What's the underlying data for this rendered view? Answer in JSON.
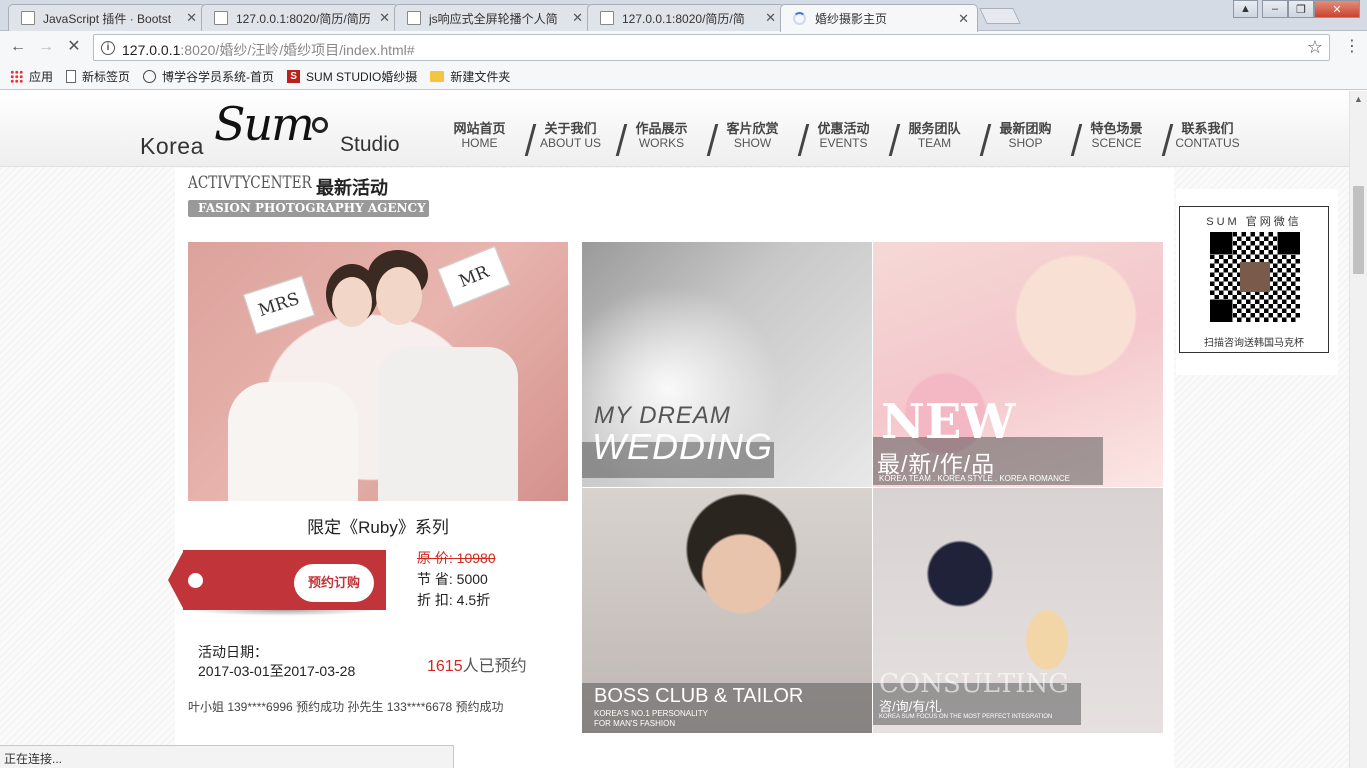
{
  "browser": {
    "tabs": [
      {
        "title": "JavaScript 插件 · Bootst",
        "active": false
      },
      {
        "title": "127.0.0.1:8020/简历/简历",
        "active": false
      },
      {
        "title": "js响应式全屏轮播个人简",
        "active": false
      },
      {
        "title": "127.0.0.1:8020/简历/简",
        "active": false
      },
      {
        "title": "婚纱摄影主页",
        "active": true
      }
    ],
    "url_host": "127.0.0.1",
    "url_path": ":8020/婚纱/汪岭/婚纱项目/index.html#",
    "bookmarks": [
      {
        "label": "应用",
        "icon": "apps-icon"
      },
      {
        "label": "新标签页",
        "icon": "page-icon"
      },
      {
        "label": "博学谷学员系统-首页",
        "icon": "globe-icon"
      },
      {
        "label": "SUM STUDIO婚纱摄",
        "icon": "s-brand-icon"
      },
      {
        "label": "新建文件夹",
        "icon": "folder-icon"
      }
    ],
    "status": "正在连接..."
  },
  "site": {
    "logo": {
      "left": "Korea",
      "mid": "Sum",
      "right": "Studio"
    },
    "nav": [
      {
        "cn": "网站首页",
        "en": "HOME"
      },
      {
        "cn": "关于我们",
        "en": "ABOUT US"
      },
      {
        "cn": "作品展示",
        "en": "WORKS"
      },
      {
        "cn": "客片欣赏",
        "en": "SHOW"
      },
      {
        "cn": "优惠活动",
        "en": "EVENTS"
      },
      {
        "cn": "服务团队",
        "en": "TEAM"
      },
      {
        "cn": "最新团购",
        "en": "SHOP"
      },
      {
        "cn": "特色场景",
        "en": "SCENCE"
      },
      {
        "cn": "联系我们",
        "en": "CONTATUS"
      }
    ],
    "section": {
      "en_title": "ACTIVTYCENTER",
      "cn_title": "最新活动",
      "banner": "FASION PHOTOGRAPHY AGENCY"
    },
    "promo": {
      "sign_left": "MRS",
      "sign_right": "MR",
      "title": "限定《Ruby》系列",
      "book_button": "预约订购",
      "original_price": "原 价: 10980",
      "saving": "节 省: 5000",
      "discount": "折 扣: 4.5折",
      "date_label": "活动日期：",
      "date_range": "2017-03-01至2017-03-28",
      "booked_count": "1615",
      "booked_suffix": "人已预约",
      "ticker": "叶小姐 139****6996 预约成功   孙先生 133****6678 预约成功"
    },
    "tiles": [
      {
        "line1": "MY DREAM",
        "line2": "WEDDING"
      },
      {
        "big": "NEW",
        "cn": "最/新/作/品",
        "small": "KOREA TEAM . KOREA STYLE . KOREA ROMANCE"
      },
      {
        "big": "BOSS CLUB & TAILOR",
        "small1": "KOREA'S NO.1 PERSONALITY",
        "small2": "FOR MAN'S FASHION"
      },
      {
        "big": "CONSULTING",
        "cn": "咨/询/有/礼",
        "small": "KOREA SUM FOCUS ON THE MOST PERFECT INTEGRATION"
      }
    ],
    "qr": {
      "title": "SUM 官网微信",
      "footer": "扫描咨询送韩国马克杯"
    }
  }
}
